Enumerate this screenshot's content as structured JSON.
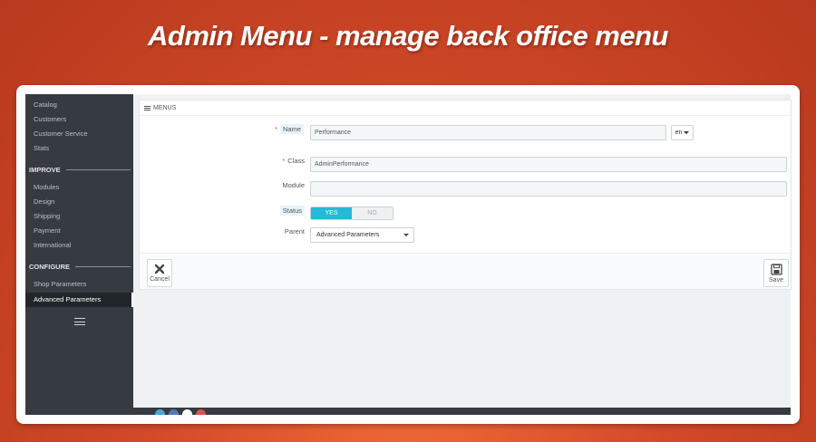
{
  "banner": {
    "title": "Admin Menu - manage back office menu"
  },
  "sidebar": {
    "items_top": [
      "Catalog",
      "Customers",
      "Customer Service",
      "Stats"
    ],
    "section_improve": "IMPROVE",
    "items_improve": [
      "Modules",
      "Design",
      "Shipping",
      "Payment",
      "International"
    ],
    "section_configure": "CONFIGURE",
    "items_configure": [
      "Shop Parameters",
      "Advanced Parameters"
    ],
    "active_item": "Advanced Parameters"
  },
  "panel": {
    "heading": "MENUS",
    "name": {
      "label": "Name",
      "value": "Performance",
      "required": "*"
    },
    "language": {
      "value": "en"
    },
    "class": {
      "label": "Class",
      "value": "AdminPerformance",
      "required": "*"
    },
    "module": {
      "label": "Module",
      "value": ""
    },
    "status": {
      "label": "Status",
      "yes": "YES",
      "no": "NO",
      "selected": "YES"
    },
    "parent": {
      "label": "Parent",
      "value": "Advanced Parameters"
    }
  },
  "footer": {
    "cancel": "Cancel",
    "save": "Save"
  },
  "colors": {
    "accent": "#25b9d7",
    "sidebar": "#363a41",
    "required": "#d9534f"
  }
}
